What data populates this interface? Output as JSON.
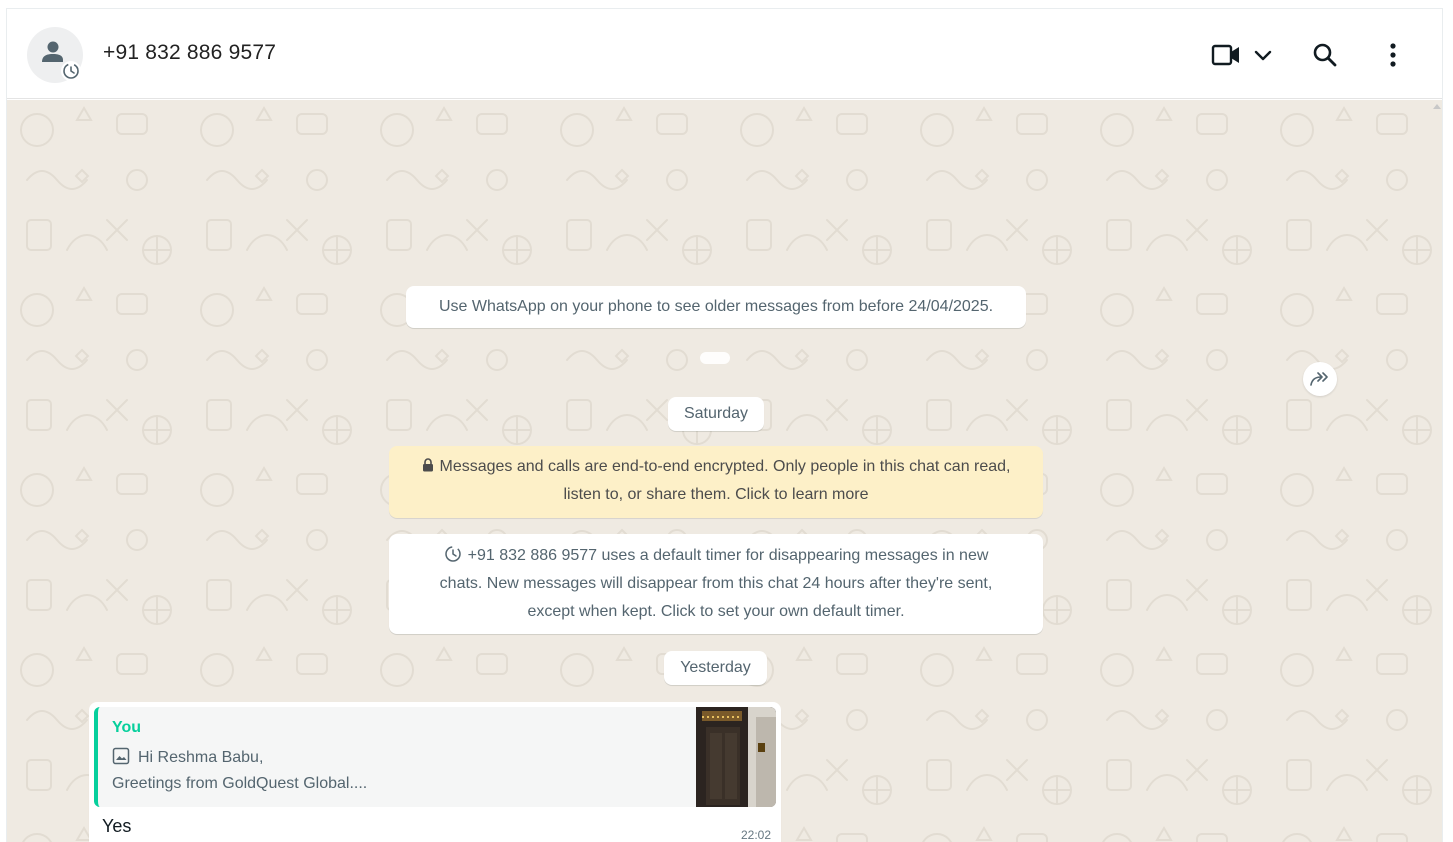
{
  "header": {
    "contact_name": "+91 832 886 9577",
    "icons": [
      "avatar-person-icon",
      "video-call-icon",
      "chevron-down-icon",
      "search-icon",
      "menu-dots-icon"
    ]
  },
  "chat": {
    "older_notice": "Use WhatsApp on your phone to see older messages from before 24/04/2025.",
    "date_saturday": "Saturday",
    "encryption_line1": "Messages and calls are end-to-end encrypted. Only people in this chat can read,",
    "encryption_line2": "listen to, or share them. Click to learn more",
    "timer_line1": "+91 832 886 9577 uses a default timer for disappearing messages in new",
    "timer_line2": "chats. New messages will disappear from this chat 24 hours after they're sent,",
    "timer_line3": "except when kept. Click to set your own default timer.",
    "date_yesterday": "Yesterday",
    "message": {
      "quote_author": "You",
      "quote_line1": "Hi Reshma Babu,",
      "quote_line2": "Greetings from GoldQuest Global....",
      "text": "Yes",
      "time": "22:02"
    }
  },
  "colors": {
    "chat_bg": "#efeae2",
    "encryption_bg": "#fdf0c8",
    "quote_accent": "#06cf9c"
  }
}
